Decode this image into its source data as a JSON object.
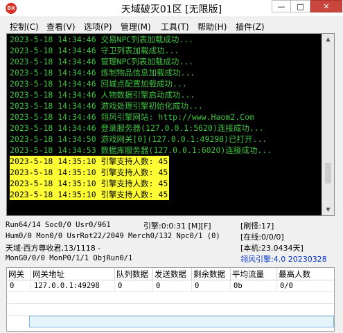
{
  "window": {
    "title": "天域破灭01区 [无限版]",
    "icon_text": "DX",
    "minimize_glyph": "—",
    "maximize_glyph": "□",
    "close_glyph": "✕"
  },
  "menu": [
    "控制(C)",
    "查看(V)",
    "选项(P)",
    "管理(M)",
    "工具(T)",
    "帮助(H)",
    "插件(Z)"
  ],
  "console": {
    "lines": [
      {
        "text": "2023-5-18 14:34:46 交易NPC列表加载成功...",
        "highlight": false
      },
      {
        "text": "2023-5-18 14:34:46 守卫列表加载成功...",
        "highlight": false
      },
      {
        "text": "2023-5-18 14:34:46 管理NPC列表加载成功...",
        "highlight": false
      },
      {
        "text": "2023-5-18 14:34:46 炼制物品信息加载成功...",
        "highlight": false
      },
      {
        "text": "2023-5-18 14:34:46 回城点配置加载成功...",
        "highlight": false
      },
      {
        "text": "2023-5-18 14:34:46 人物数据引擎启动成功...",
        "highlight": false
      },
      {
        "text": "2023-5-18 14:34:46 游戏处理引擎初始化成功...",
        "highlight": false
      },
      {
        "text": "2023-5-18 14:34:46 翎风引擎网站: http://www.Haom2.Com",
        "highlight": false
      },
      {
        "text": "2023-5-18 14:34:46 登录服务器(127.0.0.1:5620)连接成功...",
        "highlight": false
      },
      {
        "text": "2023-5-18 14:34:50 游戏网关[0](127.0.0.1:49298)已打开...",
        "highlight": false
      },
      {
        "text": "2023-5-18 14:34:53 数据库服务器(127.0.0.1:6020)连接成功...",
        "highlight": false
      },
      {
        "text": "2023-5-18 14:35:10 引擎支持人数: 45",
        "highlight": true
      },
      {
        "text": "2023-5-18 14:35:10 引擎支持人数: 45",
        "highlight": true
      },
      {
        "text": "2023-5-18 14:35:10 引擎支持人数: 45",
        "highlight": true
      },
      {
        "text": "2023-5-18 14:35:10 引擎支持人数: 45",
        "highlight": true
      }
    ],
    "scroll_up_glyph": "▲",
    "scroll_down_glyph": "▼"
  },
  "status": {
    "run": "Run64/14 Soc0/0 Usr0/961",
    "engine_time": "引擎:0:0:31 [M][F]",
    "refresh": "[刷怪:17]",
    "hum": "Hum0/0 Mon0/0 UsrRot22/2049 Merch0/132 Npc0/1 (0)",
    "online": "[在线:0/0/0]",
    "realm": "天域·西方尊收君,13/1118 -",
    "uptime": "[本机:23.0434天]",
    "mon": "MonG0/0/0 MonP0/1/1 ObjRun0/1",
    "version": "翎风引擎:4.0 20230328"
  },
  "table": {
    "headers": [
      "网关",
      "网关地址",
      "队列数据",
      "发送数据",
      "剩余数据",
      "平均流量",
      "最高人数"
    ],
    "rows": [
      [
        "0",
        "127.0.0.1:49298",
        "0",
        "0",
        "0",
        "0b",
        "0/0"
      ]
    ]
  },
  "colors": {
    "console_bg": "#000000",
    "console_text": "#3ec43e",
    "highlight_bg": "#ffff33",
    "version_text": "#0033cc",
    "close_button": "#c8463c"
  }
}
